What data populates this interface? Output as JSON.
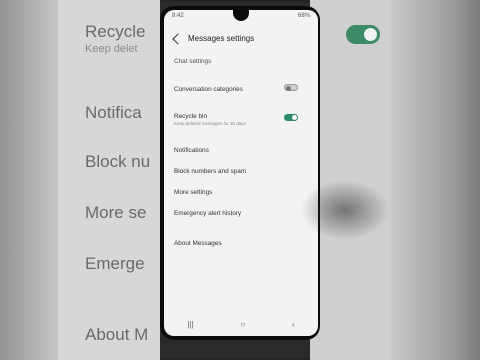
{
  "background": {
    "items": [
      "Recycle",
      "Notifica",
      "Block nu",
      "More se",
      "Emerge",
      "About M"
    ],
    "recycle_sub": "Keep delet"
  },
  "status_bar": {
    "time": "8:42",
    "battery": "68%"
  },
  "header": {
    "title": "Messages settings"
  },
  "sections": {
    "chat_settings": "Chat settings"
  },
  "settings": {
    "conversation_categories": "Conversation categories",
    "recycle_bin": "Recycle bin",
    "recycle_bin_sub": "Keep deleted messages for 30 days.",
    "notifications": "Notifications",
    "block_numbers": "Block numbers and spam",
    "more_settings": "More settings",
    "emergency_alert": "Emergency alert history",
    "about_messages": "About Messages"
  },
  "toggles": {
    "conversation_categories": "off",
    "recycle_bin": "on"
  },
  "nav": {
    "recents": "|||",
    "home": "○",
    "back": "‹"
  },
  "colors": {
    "accent": "#2a8c6a"
  }
}
